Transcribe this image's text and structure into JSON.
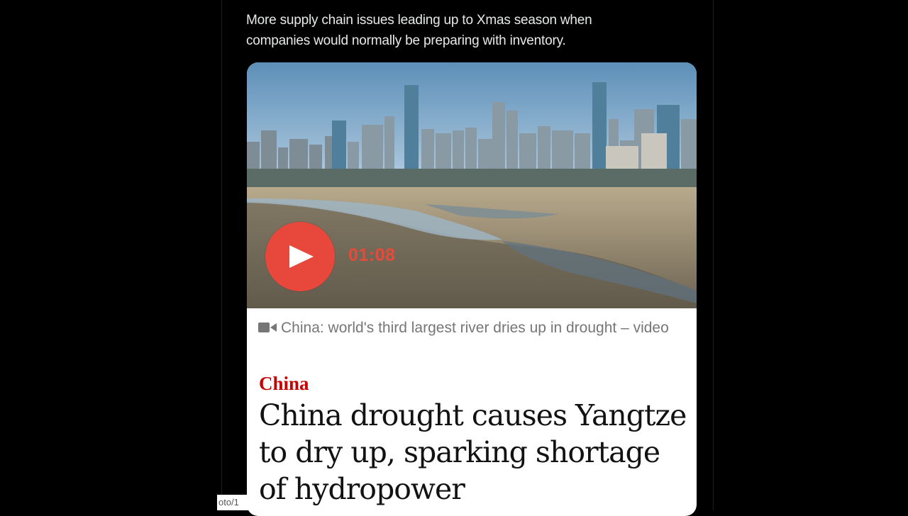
{
  "tweet": {
    "text": "More supply chain issues leading up to Xmas season when\ncompanies would normally be preparing with inventory."
  },
  "video": {
    "duration": "01:08",
    "play_icon": "play-icon",
    "accent_color": "#e8473c"
  },
  "article": {
    "caption": "China: world's third largest river dries up in drought – video",
    "caption_icon": "video-camera-icon",
    "kicker": "China",
    "kicker_color": "#c70000",
    "headline": "China drought causes Yangtze to dry up, sparking shortage of hydropower"
  },
  "overlay": {
    "corner_label": "oto/1"
  }
}
